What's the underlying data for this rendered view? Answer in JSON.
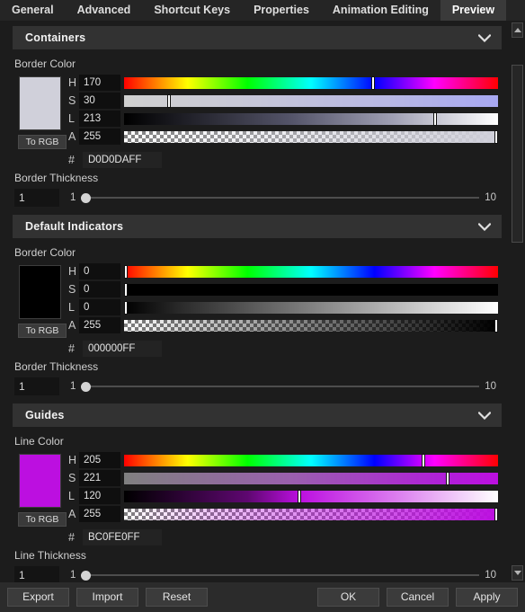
{
  "tabs": [
    {
      "label": "General",
      "active": false
    },
    {
      "label": "Advanced",
      "active": false
    },
    {
      "label": "Shortcut Keys",
      "active": false
    },
    {
      "label": "Properties",
      "active": false
    },
    {
      "label": "Animation Editing",
      "active": false
    },
    {
      "label": "Preview",
      "active": true
    }
  ],
  "sections": [
    {
      "title": "Containers",
      "color_label": "Border Color",
      "to_rgb_label": "To RGB",
      "swatch_color": "#d0d0da",
      "channels": [
        {
          "name": "H",
          "value": "170",
          "pos_pct": 66.5
        },
        {
          "name": "S",
          "value": "30",
          "pos_pct": 12.0
        },
        {
          "name": "L",
          "value": "213",
          "pos_pct": 83.2
        },
        {
          "name": "A",
          "value": "255",
          "pos_pct": 99.4
        }
      ],
      "hex_symbol": "#",
      "hex_value": "D0D0DAFF",
      "thickness_label": "Border Thickness",
      "thickness_value": "1",
      "thickness_min": "1",
      "thickness_max": "10",
      "thickness_pos_pct": 0
    },
    {
      "title": "Default Indicators",
      "color_label": "Border Color",
      "to_rgb_label": "To RGB",
      "swatch_color": "#000000",
      "channels": [
        {
          "name": "H",
          "value": "0",
          "pos_pct": 0.4
        },
        {
          "name": "S",
          "value": "0",
          "pos_pct": 0.4
        },
        {
          "name": "L",
          "value": "0",
          "pos_pct": 0.4
        },
        {
          "name": "A",
          "value": "255",
          "pos_pct": 99.4
        }
      ],
      "hex_symbol": "#",
      "hex_value": "000000FF",
      "thickness_label": "Border Thickness",
      "thickness_value": "1",
      "thickness_min": "1",
      "thickness_max": "10",
      "thickness_pos_pct": 0
    },
    {
      "title": "Guides",
      "color_label": "Line Color",
      "to_rgb_label": "To RGB",
      "swatch_color": "#bc0fe0",
      "channels": [
        {
          "name": "H",
          "value": "205",
          "pos_pct": 80.1
        },
        {
          "name": "S",
          "value": "221",
          "pos_pct": 86.5
        },
        {
          "name": "L",
          "value": "120",
          "pos_pct": 46.9
        },
        {
          "name": "A",
          "value": "255",
          "pos_pct": 99.4
        }
      ],
      "hex_symbol": "#",
      "hex_value": "BC0FE0FF",
      "thickness_label": "Line Thickness",
      "thickness_value": "1",
      "thickness_min": "1",
      "thickness_max": "10",
      "thickness_pos_pct": 0
    }
  ],
  "scrollbar": {
    "up_icon": "triangle-up-icon",
    "down_icon": "triangle-down-icon"
  },
  "bottom_bar": {
    "export_label": "Export",
    "import_label": "Import",
    "reset_label": "Reset",
    "ok_label": "OK",
    "cancel_label": "Cancel",
    "apply_label": "Apply"
  },
  "gradients": {
    "hue": "linear-gradient(to right,#ff0000 0%,#ffff00 17%,#00ff00 33%,#00ffff 50%,#0000ff 67%,#ff00ff 83%,#ff0000 100%)",
    "containers_sat": "linear-gradient(to right,#d0d0d0 0%,#c8c8d6 30%,#b8b8e4 70%,#a8a8f2 100%)",
    "containers_lum": "linear-gradient(to right,#000000 0%,#55556a 45%,#a0a0b4 72%,#ffffff 100%)",
    "containers_alpha": "linear-gradient(to right,rgba(208,208,218,0) 0%,rgba(208,208,218,1) 100%)",
    "indicators_sat": "linear-gradient(to right,#000000 0%,#000000 100%)",
    "indicators_lum": "linear-gradient(to right,#000000 0%,#2a2a2a 15%,#808080 50%,#ffffff 100%)",
    "indicators_alpha": "linear-gradient(to right,rgba(0,0,0,0) 0%,rgba(0,0,0,1) 100%)",
    "guides_sat": "linear-gradient(to right,#808080 0%,#9a5fae 45%,#b020d8 85%,#bc0fe0 100%)",
    "guides_lum": "linear-gradient(to right,#000000 0%,#5e0770 33%,#bc0fe0 47%,#de87f0 75%,#ffffff 100%)",
    "guides_alpha": "linear-gradient(to right,rgba(188,15,224,0) 0%,rgba(188,15,224,1) 100%)"
  }
}
